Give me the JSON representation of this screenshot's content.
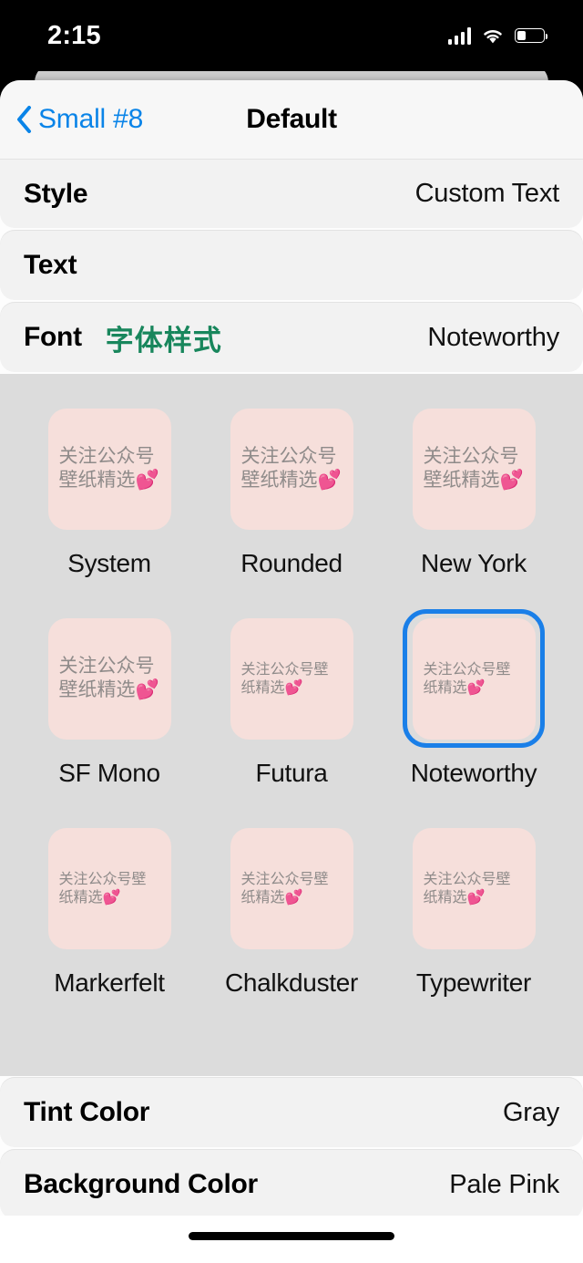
{
  "status_bar": {
    "time": "2:15",
    "signal_icon": "cellular-signal-icon",
    "wifi_icon": "wifi-icon",
    "battery_icon": "battery-icon",
    "battery_level_percent": 33
  },
  "nav": {
    "back_label": "Small #8",
    "back_icon": "chevron-left-icon",
    "title": "Default"
  },
  "settings": {
    "style": {
      "label": "Style",
      "value": "Custom Text"
    },
    "text": {
      "label": "Text",
      "value": ""
    },
    "font": {
      "label": "Font",
      "accent_sample": "字体样式",
      "value": "Noteworthy"
    },
    "tint_color": {
      "label": "Tint Color",
      "value": "Gray"
    },
    "background_color": {
      "label": "Background Color",
      "value": "Pale Pink"
    }
  },
  "font_grid": {
    "preview_text_line1": "关注公众号",
    "preview_text_line2": "壁纸精选",
    "preview_emoji": "💕",
    "selected": "Noteworthy",
    "items": [
      {
        "name": "System",
        "preview_size": "large",
        "selected": false
      },
      {
        "name": "Rounded",
        "preview_size": "large",
        "selected": false
      },
      {
        "name": "New York",
        "preview_size": "large",
        "selected": false
      },
      {
        "name": "SF Mono",
        "preview_size": "large",
        "selected": false
      },
      {
        "name": "Futura",
        "preview_size": "small",
        "selected": false
      },
      {
        "name": "Noteworthy",
        "preview_size": "small",
        "selected": true
      },
      {
        "name": "Markerfelt",
        "preview_size": "small",
        "selected": false
      },
      {
        "name": "Chalkduster",
        "preview_size": "small",
        "selected": false
      },
      {
        "name": "Typewriter",
        "preview_size": "small",
        "selected": false
      }
    ]
  },
  "colors": {
    "accent_blue": "#0a84e8",
    "selection_blue": "#1a7fe8",
    "sample_green": "#18865c",
    "tile_pink": "#f6dfdb",
    "grid_background": "#dcdcdc",
    "row_background": "#f2f2f2"
  },
  "home_indicator": "home-indicator"
}
